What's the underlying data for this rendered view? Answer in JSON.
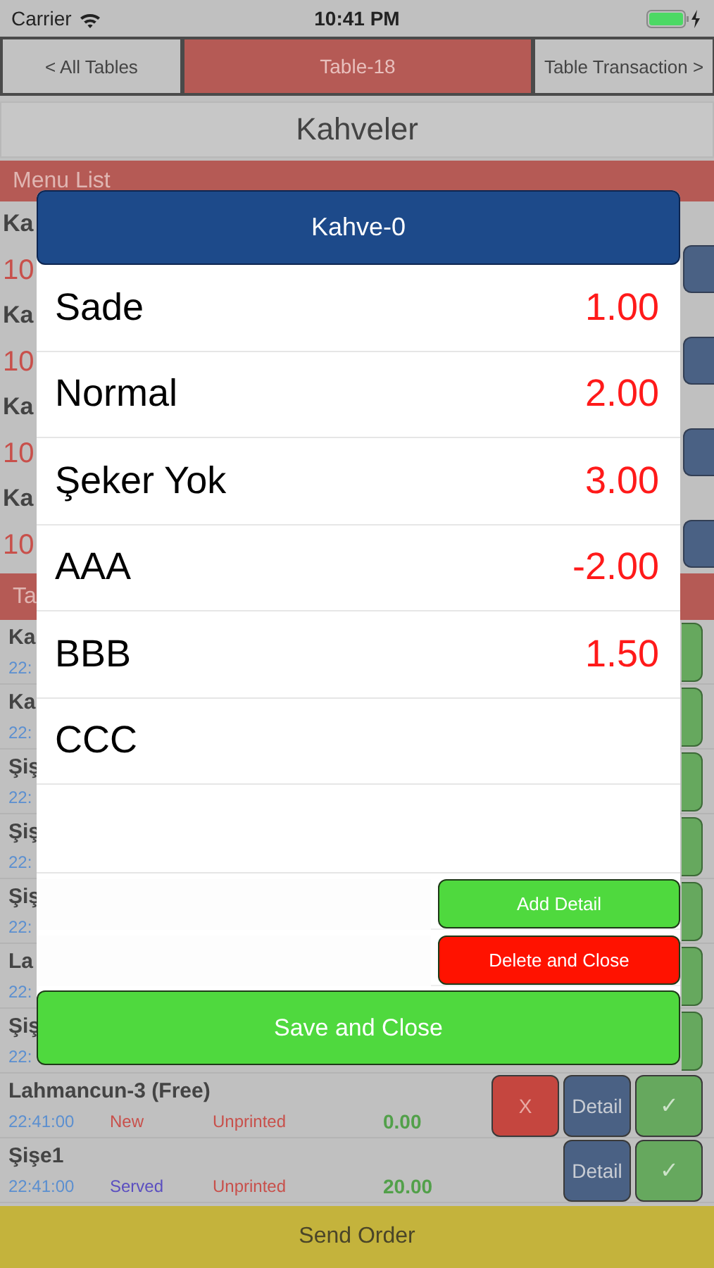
{
  "status_bar": {
    "carrier": "Carrier",
    "time": "10:41 PM"
  },
  "nav": [
    {
      "label": "< All Tables",
      "selected": false
    },
    {
      "label": "Table-18",
      "selected": true
    },
    {
      "label": "Table Transaction >",
      "selected": false
    }
  ],
  "category_title": "Kahveler",
  "menu_list": {
    "title": "Menu List",
    "items": [
      {
        "name": "Ka",
        "price": "10"
      },
      {
        "name": "Ka",
        "price": "10"
      },
      {
        "name": "Ka",
        "price": "10"
      },
      {
        "name": "Ka",
        "price": "10"
      }
    ]
  },
  "table_list": {
    "title": "Ta",
    "rows": [
      {
        "kind": "partial",
        "name": "Ka",
        "time": "22:"
      },
      {
        "kind": "partial",
        "name": "Ka",
        "time": "22:"
      },
      {
        "kind": "partial",
        "name": "Şiş",
        "time": "22:"
      },
      {
        "kind": "partial",
        "name": "Şiş",
        "time": "22:"
      },
      {
        "kind": "partial",
        "name": "Şiş",
        "time": "22:"
      },
      {
        "kind": "partial",
        "name": "La",
        "time": "22:"
      },
      {
        "kind": "partial",
        "name": "Şiş",
        "time": "22:"
      },
      {
        "kind": "full",
        "name": "Lahmancun-3 (Free)",
        "time": "22:41:00",
        "status": "New",
        "color": "#c8504b",
        "print_status": "Unprinted",
        "amount": "0.00",
        "buttons": [
          "X",
          "Detail",
          "✓"
        ]
      },
      {
        "kind": "full",
        "name": "Şişe1",
        "time": "22:41:00",
        "status": "Served",
        "color": "#5b4fc0",
        "print_status": "Unprinted",
        "amount": "20.00",
        "buttons": [
          "Detail",
          "✓"
        ]
      }
    ]
  },
  "send_button": "Send Order",
  "dialog": {
    "title": "Kahve-0",
    "options": [
      {
        "name": "Sade",
        "price": "1.00"
      },
      {
        "name": "Normal",
        "price": "2.00"
      },
      {
        "name": "Şeker Yok",
        "price": "3.00"
      },
      {
        "name": "AAA",
        "price": "-2.00"
      },
      {
        "name": "BBB",
        "price": "1.50"
      },
      {
        "name": "CCC"
      }
    ],
    "add_button": "Add Detail",
    "delete_button": "Delete and Close",
    "save_button": "Save and Close"
  }
}
